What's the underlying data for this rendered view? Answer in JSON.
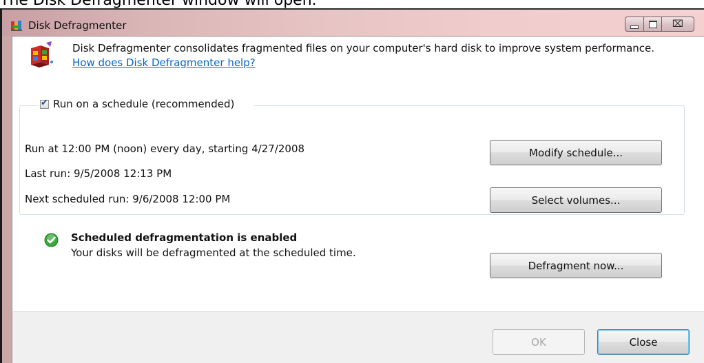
{
  "caption": "The Disk Defragmenter window will open.",
  "window": {
    "title": "Disk Defragmenter",
    "controls": {
      "minimize_icon": "minimize-icon",
      "maximize_icon": "maximize-icon",
      "close_glyph": "⌧"
    }
  },
  "intro": {
    "text": "Disk Defragmenter consolidates fragmented files on your computer's hard disk to improve system performance. ",
    "link": "How does Disk Defragmenter help?"
  },
  "schedule": {
    "checkbox_label": "Run on a schedule (recommended)",
    "checked": true,
    "run_at": "Run at 12:00 PM (noon) every day, starting 4/27/2008",
    "last_run": "Last run: 9/5/2008 12:13 PM",
    "next_run": "Next scheduled run: 9/6/2008 12:00 PM",
    "modify_button": "Modify schedule...",
    "select_button": "Select volumes..."
  },
  "status": {
    "icon": "check-circle-icon",
    "title": "Scheduled defragmentation is enabled",
    "subtitle": "Your disks will be defragmented at the scheduled time.",
    "defrag_button": "Defragment now..."
  },
  "footer": {
    "ok_button": "OK",
    "close_button": "Close"
  },
  "colors": {
    "link": "#0066cc",
    "check_green": "#3aa83a",
    "titlebar_tint": "#e7c4c4"
  }
}
